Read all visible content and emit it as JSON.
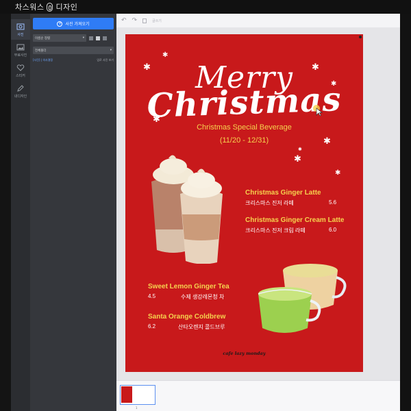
{
  "app": {
    "title": "차스워스 디자인"
  },
  "rail": {
    "items": [
      {
        "label": "사진",
        "icon": "photo-icon",
        "active": true
      },
      {
        "label": "무료사진",
        "icon": "free-photo-icon",
        "active": false
      },
      {
        "label": "스티커",
        "icon": "heart-icon",
        "active": false
      },
      {
        "label": "내디자인",
        "icon": "pencil-icon",
        "active": false
      }
    ]
  },
  "panel": {
    "upload_label": "사진 가져오기",
    "sort_select": "이름순 정렬",
    "filter_select": "전체폴더",
    "link_left": "[사진] | 의사결정",
    "link_right": "업로 사진 보기"
  },
  "toolbar": {
    "undo": "↶",
    "redo": "↷",
    "view_label": "글쓰기"
  },
  "poster": {
    "title_line1": "Merry",
    "title_line2": "Christmas",
    "subtitle": "Christmas Special Beverage",
    "dates": "(11/20 - 12/31)",
    "menu": [
      {
        "name": "Christmas Ginger Latte",
        "korean": "크리스마스 진저 라떼",
        "price": "5.6"
      },
      {
        "name": "Christmas Ginger Cream Latte",
        "korean": "크리스마스 진저 크림 라떼",
        "price": "6.0"
      },
      {
        "name": "Sweet Lemon Ginger Tea",
        "price": "4.5",
        "korean": "수제 생강레몬청 차"
      },
      {
        "name": "Santa Orange Coldbrew",
        "price": "6.2",
        "korean": "산타오렌지 콜드브루"
      }
    ],
    "footer": "cafe lazy monday"
  },
  "pages": {
    "current_number": "1"
  },
  "colors": {
    "poster_bg": "#c8191b",
    "accent_yellow": "#f6d24e",
    "upload_blue": "#2f7cf6"
  }
}
